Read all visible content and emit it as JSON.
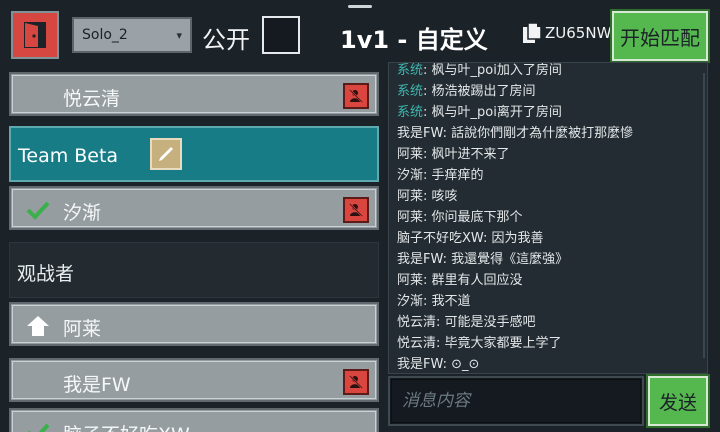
{
  "header": {
    "mode": "Solo_2",
    "public_label": "公开",
    "room_title": "1v1 - 自定义",
    "room_code": "ZU65NW",
    "start_label": "开始匹配"
  },
  "left_list": {
    "rows": [
      {
        "type": "player",
        "name": "悦云清",
        "ready": false,
        "host": false
      },
      {
        "type": "team",
        "name": "Team Beta"
      },
      {
        "type": "player",
        "name": "汐渐",
        "ready": true,
        "host": false
      },
      {
        "type": "spectator",
        "name": "观战者"
      },
      {
        "type": "player",
        "name": "阿莱",
        "ready": false,
        "host": true
      },
      {
        "type": "player",
        "name": "我是FW",
        "ready": false,
        "host": false
      },
      {
        "type": "player",
        "name": "脑子不好吃XW",
        "ready": true,
        "host": false
      }
    ]
  },
  "chat": {
    "lines": [
      {
        "prefix": "系统",
        "text": "枫与叶_poi加入了房间"
      },
      {
        "prefix": "系统",
        "text": "杨浩被踢出了房间"
      },
      {
        "prefix": "系统",
        "text": "枫与叶_poi离开了房间"
      },
      {
        "prefix": "我是FW",
        "text": "話說你們剛才為什麼被打那麼慘"
      },
      {
        "prefix": "阿莱",
        "text": "枫叶进不来了"
      },
      {
        "prefix": "汐渐",
        "text": "手痒痒的"
      },
      {
        "prefix": "阿莱",
        "text": "咳咳"
      },
      {
        "prefix": "阿莱",
        "text": "你问最底下那个"
      },
      {
        "prefix": "脑子不好吃XW",
        "text": "因为我善"
      },
      {
        "prefix": "我是FW",
        "text": "我還覺得《這麼強》"
      },
      {
        "prefix": "阿莱",
        "text": "群里有人回应没"
      },
      {
        "prefix": "汐渐",
        "text": "我不道"
      },
      {
        "prefix": "悦云清",
        "text": "可能是没手感吧"
      },
      {
        "prefix": "悦云清",
        "text": "毕竟大家都要上学了"
      },
      {
        "prefix": "我是FW",
        "text": "⊙_⊙"
      }
    ],
    "input_placeholder": "消息内容",
    "send_label": "发送",
    "system_color": "#3fb7b0"
  },
  "colors": {
    "accent_green": "#55b84e",
    "kick_red": "#d9453f",
    "team_teal": "#187c87",
    "check_green": "#3ab04a"
  },
  "icons": [
    "exit-door-icon",
    "chevron-down-icon",
    "document-icon",
    "kick-player-icon",
    "pencil-icon",
    "check-icon",
    "home-icon"
  ]
}
